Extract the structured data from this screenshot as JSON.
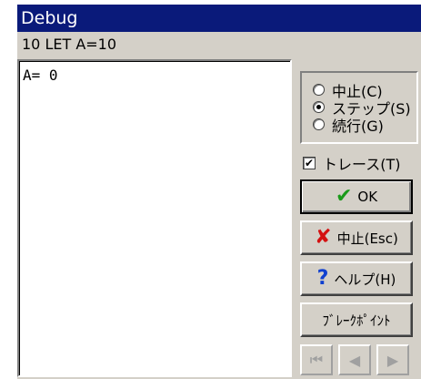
{
  "window": {
    "title": "Debug"
  },
  "status_line": "10 LET A=10",
  "output": {
    "text": "A= 0"
  },
  "mode_group": {
    "options": [
      {
        "label": "中止(C)",
        "checked": false
      },
      {
        "label": "ステップ(S)",
        "checked": true
      },
      {
        "label": "続行(G)",
        "checked": false
      }
    ]
  },
  "trace": {
    "label": "トレース(T)",
    "checked": true
  },
  "buttons": {
    "ok": "OK",
    "abort": "中止(Esc)",
    "help": "ヘルプ(H)",
    "breakpoint": "ﾌﾞﾚｰｸﾎﾟｲﾝﾄ"
  },
  "icons": {
    "ok": "check-icon",
    "abort": "x-icon",
    "help": "question-icon",
    "first": "skip-first-icon",
    "prev": "prev-icon",
    "next": "next-icon"
  },
  "colors": {
    "titlebar": "#0a1a7a",
    "face": "#d4d0c8",
    "ok_check": "#1a9a1a",
    "abort_x": "#d41010",
    "help_q": "#1040d0"
  }
}
